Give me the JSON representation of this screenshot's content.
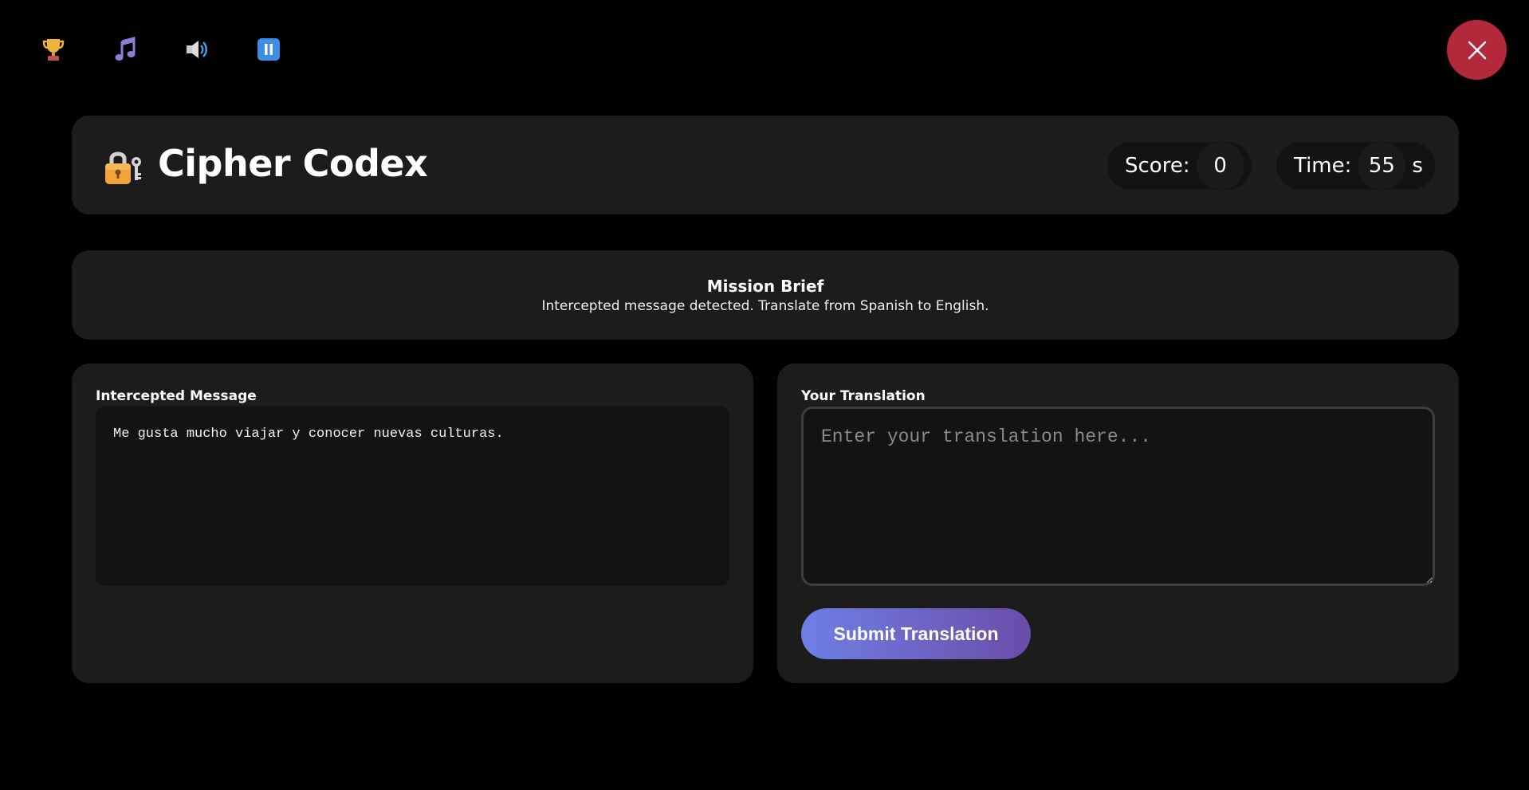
{
  "toolbar": {
    "icons": [
      "trophy-icon",
      "music-icon",
      "sound-icon",
      "pause-icon"
    ],
    "close_icon": "close-icon"
  },
  "header": {
    "icon": "lock-key-icon",
    "title": "Cipher Codex",
    "score_label": "Score:",
    "score_value": "0",
    "time_label": "Time:",
    "time_value": "55",
    "time_unit": "s"
  },
  "brief": {
    "title": "Mission Brief",
    "text": "Intercepted message detected. Translate from Spanish to English."
  },
  "intercepted": {
    "label": "Intercepted Message",
    "message": "Me gusta mucho viajar y conocer nuevas culturas."
  },
  "translation": {
    "label": "Your Translation",
    "value": "",
    "placeholder": "Enter your translation here...",
    "submit_label": "Submit Translation"
  },
  "colors": {
    "background": "#000000",
    "panel": "#1c1c1c",
    "close_button": "#b4283c",
    "submit_gradient_start": "#6f7fe6",
    "submit_gradient_end": "#6a4da8"
  }
}
